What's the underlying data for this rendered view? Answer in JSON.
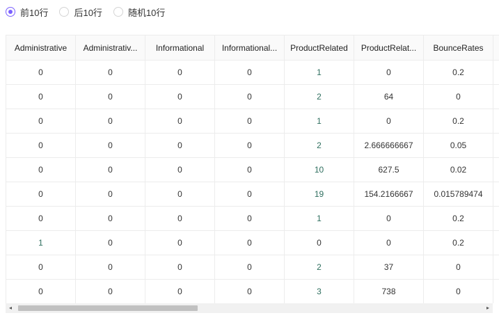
{
  "radios": [
    {
      "label": "前10行",
      "checked": true
    },
    {
      "label": "后10行",
      "checked": false
    },
    {
      "label": "随机10行",
      "checked": false
    }
  ],
  "columns": [
    "Administrative",
    "Administrativ...",
    "Informational",
    "Informational...",
    "ProductRelated",
    "ProductRelat...",
    "BounceRates",
    ""
  ],
  "rows": [
    [
      "0",
      "0",
      "0",
      "0",
      "1",
      "0",
      "0.2",
      ""
    ],
    [
      "0",
      "0",
      "0",
      "0",
      "2",
      "64",
      "0",
      ""
    ],
    [
      "0",
      "0",
      "0",
      "0",
      "1",
      "0",
      "0.2",
      ""
    ],
    [
      "0",
      "0",
      "0",
      "0",
      "2",
      "2.666666667",
      "0.05",
      ""
    ],
    [
      "0",
      "0",
      "0",
      "0",
      "10",
      "627.5",
      "0.02",
      ""
    ],
    [
      "0",
      "0",
      "0",
      "0",
      "19",
      "154.2166667",
      "0.015789474",
      ""
    ],
    [
      "0",
      "0",
      "0",
      "0",
      "1",
      "0",
      "0.2",
      ""
    ],
    [
      "1",
      "0",
      "0",
      "0",
      "0",
      "0",
      "0.2",
      ""
    ],
    [
      "0",
      "0",
      "0",
      "0",
      "2",
      "37",
      "0",
      ""
    ],
    [
      "0",
      "0",
      "0",
      "0",
      "3",
      "738",
      "0",
      ""
    ]
  ],
  "colors": {
    "accent": "#7b61ff",
    "border": "#ececec"
  },
  "icons": {
    "scroll_left": "triangle-left",
    "scroll_right": "triangle-right"
  },
  "scrollbar_arrows": {
    "left": "◂",
    "right": "▸"
  }
}
